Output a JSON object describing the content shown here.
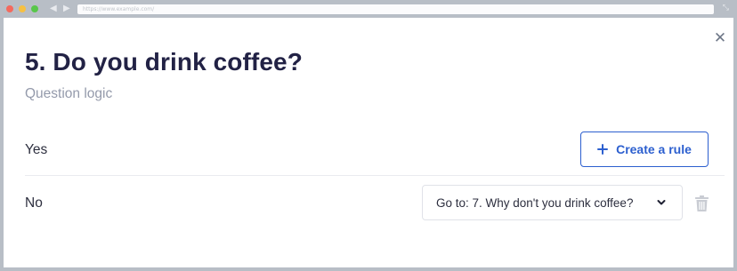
{
  "browser": {
    "url": "https://www.example.com/",
    "back_icon": "back-arrow-icon",
    "forward_icon": "forward-arrow-icon",
    "expand_icon": "expand-icon"
  },
  "modal": {
    "close_icon": "close-icon",
    "title": "5. Do you drink coffee?",
    "subtitle": "Question logic",
    "rows": [
      {
        "answer": "Yes",
        "action": {
          "type": "button",
          "icon": "plus-icon",
          "label": "Create a rule"
        }
      },
      {
        "answer": "No",
        "action": {
          "type": "select",
          "value": "Go to: 7. Why don't you drink coffee?",
          "icon": "chevron-down-icon"
        },
        "delete_icon": "trash-icon"
      }
    ]
  },
  "colors": {
    "title": "#222245",
    "subtitle": "#949aab",
    "accent": "#2c5fcf",
    "border": "#e0e2e8",
    "chrome": "#b8bec6"
  }
}
